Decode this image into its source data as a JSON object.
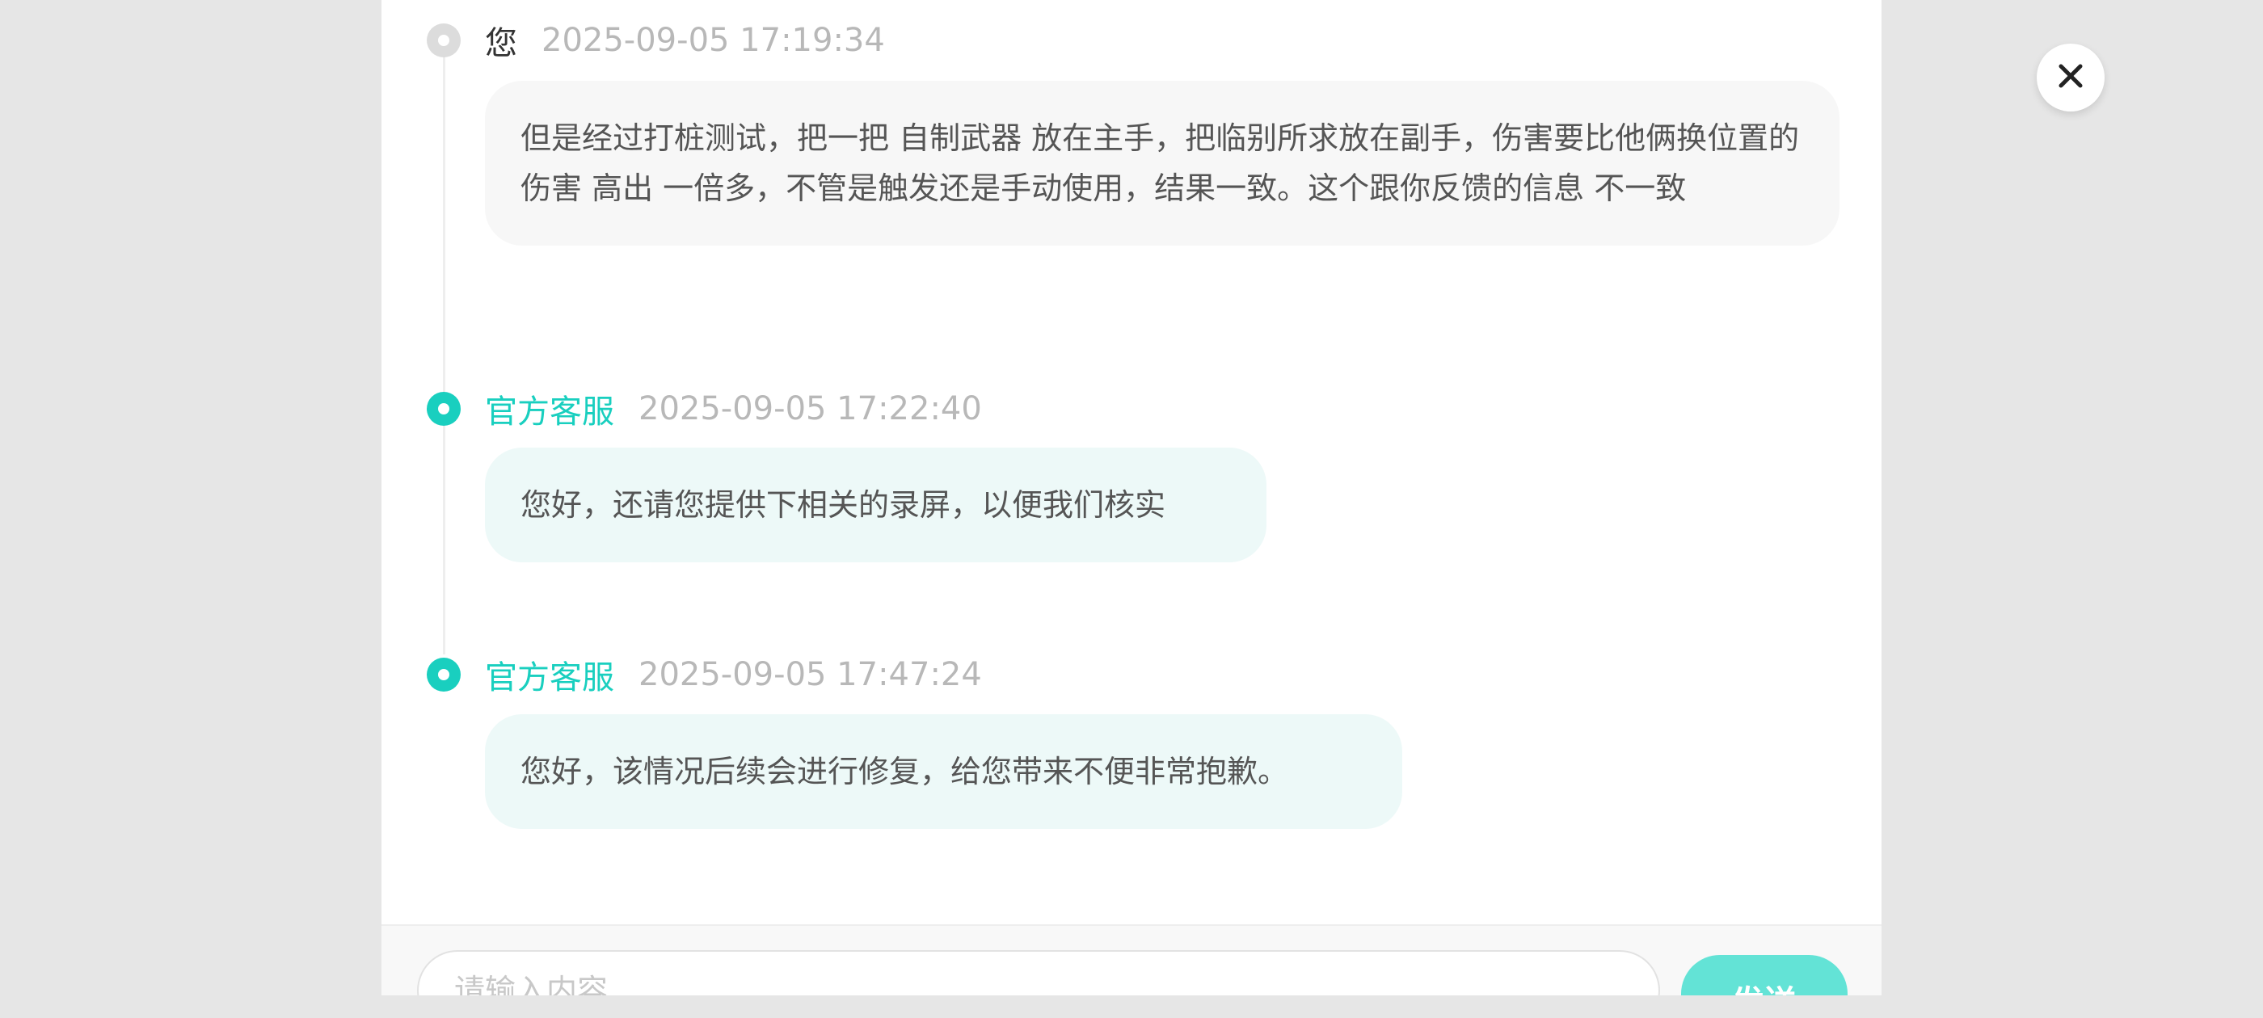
{
  "messages": [
    {
      "sender": "您",
      "role": "user",
      "time": "2025-09-05 17:19:34",
      "text": "但是经过打桩测试，把一把 自制武器 放在主手，把临别所求放在副手，伤害要比他俩换位置的伤害 高出 一倍多，不管是触发还是手动使用，结果一致。这个跟你反馈的信息 不一致"
    },
    {
      "sender": "官方客服",
      "role": "agent",
      "time": "2025-09-05 17:22:40",
      "text": "您好，还请您提供下相关的录屏，以便我们核实"
    },
    {
      "sender": "官方客服",
      "role": "agent",
      "time": "2025-09-05 17:47:24",
      "text": "您好，该情况后续会进行修复，给您带来不便非常抱歉。"
    }
  ],
  "composer": {
    "placeholder": "请输入内容",
    "send_label": "发送"
  },
  "close_icon": "close-icon",
  "colors": {
    "accent": "#19cfbf",
    "agent_bubble": "#edf9f8",
    "user_bubble": "#f7f7f7",
    "send_button": "#63e3d6"
  }
}
